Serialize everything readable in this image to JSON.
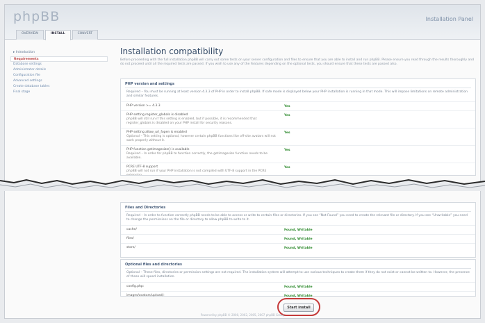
{
  "header": {
    "logo": "phpBB",
    "panel_title": "Installation Panel",
    "tabs": [
      "OVERVIEW",
      "INSTALL",
      "CONVERT"
    ],
    "active_tab": 1
  },
  "sidebar": {
    "heading": "▸ Introduction",
    "items": [
      "Requirements",
      "Database settings",
      "Administrator details",
      "Configuration file",
      "Advanced settings",
      "Create database tables",
      "Final stage"
    ],
    "active_index": 0
  },
  "main": {
    "title": "Installation compatibility",
    "intro": "Before proceeding with the full installation phpBB will carry out some tests on your server configuration and files to ensure that you are able to install and run phpBB. Please ensure you read through the results thoroughly and do not proceed until all the required tests are passed. If you wish to use any of the features depending on the optional tests, you should ensure that these tests are passed also."
  },
  "php_box": {
    "title": "PHP version and settings",
    "desc": "Required – You must be running at least version 4.3.3 of PHP in order to install phpBB. If safe mode is displayed below your PHP installation is running in that mode. This will impose limitations on remote administration and similar features.",
    "rows": [
      {
        "label": "PHP version >= 4.3.3",
        "note": "",
        "value": "Yes"
      },
      {
        "label": "PHP setting register_globals is disabled",
        "note": "phpBB will still run if this setting is enabled, but if possible, it is recommended that register_globals is disabled on your PHP install for security reasons.",
        "value": "Yes"
      },
      {
        "label": "PHP setting allow_url_fopen is enabled",
        "note": "Optional – This setting is optional, however certain phpBB functions like off-site avatars will not work properly without it.",
        "value": "Yes"
      },
      {
        "label": "PHP function getimagesize() is available",
        "note": "Required – In order for phpBB to function correctly, the getimagesize function needs to be available.",
        "value": "Yes"
      },
      {
        "label": "PCRE UTF-8 support",
        "note": "phpBB will not run if your PHP installation is not compiled with UTF-8 support in the PCRE extension.",
        "value": "Yes"
      }
    ]
  },
  "files_box": {
    "title": "Files and Directories",
    "desc": "Required – In order to function correctly phpBB needs to be able to access or write to certain files or directories. If you see “Not Found” you need to create the relevant file or directory. If you see “Unwritable” you need to change the permissions on the file or directory to allow phpBB to write to it.",
    "rows": [
      {
        "label": "cache/",
        "value": "Found, Writable"
      },
      {
        "label": "files/",
        "value": "Found, Writable"
      },
      {
        "label": "store/",
        "value": "Found, Writable"
      }
    ]
  },
  "optional_box": {
    "title": "Optional files and directories",
    "desc": "Optional – These files, directories or permission settings are not required. The installation system will attempt to use various techniques to create them if they do not exist or cannot be written to. However, the presence of these will speed installation.",
    "rows": [
      {
        "label": "config.php:",
        "value": "Found, Writable"
      },
      {
        "label": "images/avatars/upload/:",
        "value": "Found, Writable"
      }
    ]
  },
  "start_button": "Start install",
  "footer": "Powered by phpBB © 2000, 2002, 2005, 2007 phpBB Group",
  "colors": {
    "ok": "#2f8b2f",
    "highlight": "#c53a3a",
    "heading": "#334a66"
  }
}
